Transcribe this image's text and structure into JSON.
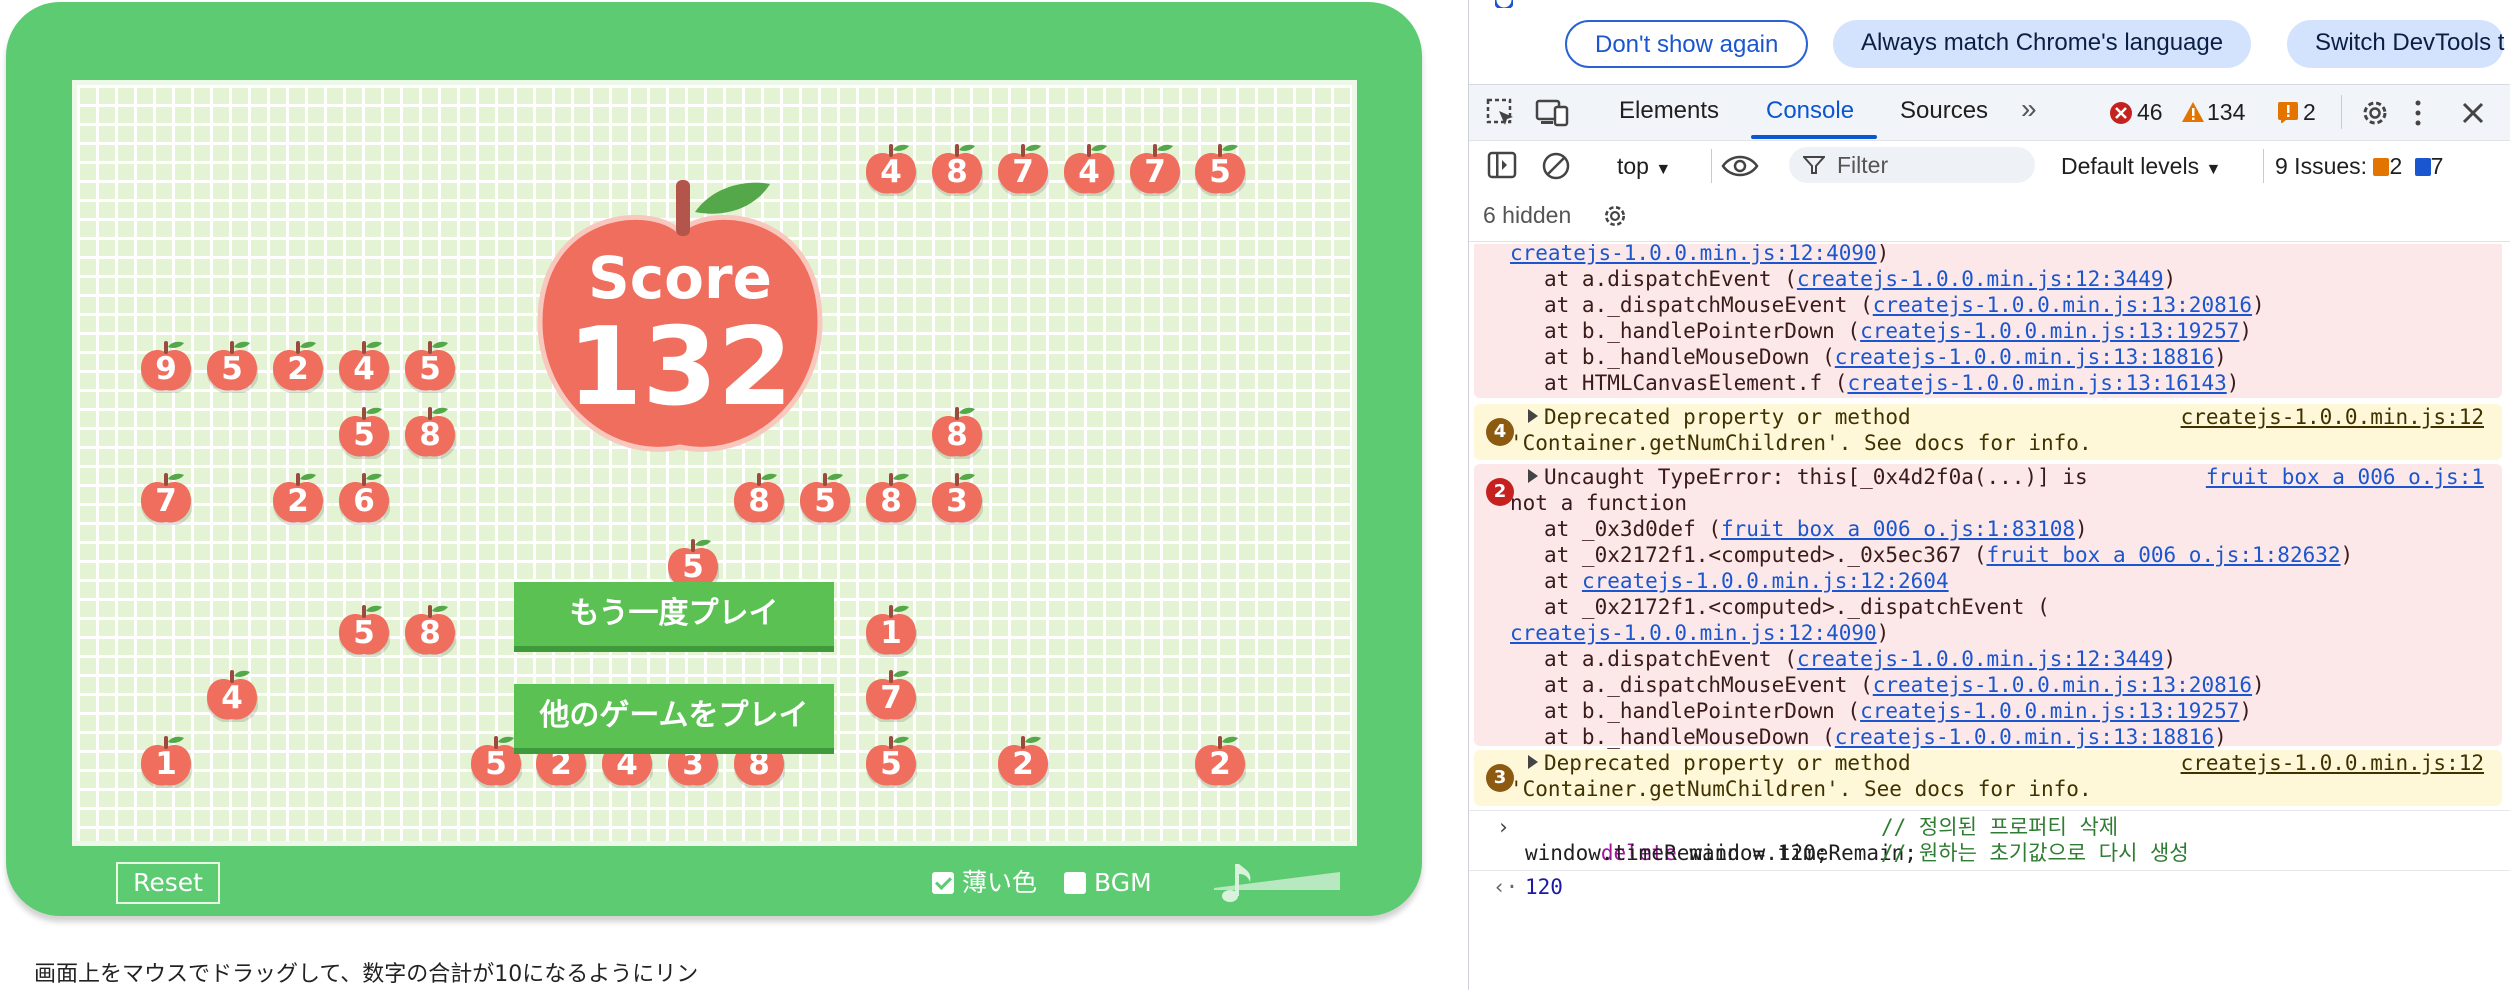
{
  "game": {
    "score_label": "Score",
    "score_value": "132",
    "play_again_label": "もう一度プレイ",
    "other_games_label": "他のゲームをプレイ",
    "reset_label": "Reset",
    "light_color_label": "薄い色",
    "light_color_checked": true,
    "bgm_label": "BGM",
    "bgm_checked": false,
    "volume_level": 0.0,
    "caption": "画面上をマウスでドラッグして、数字の合計が10になるようにリン",
    "apple_color": "#ef6e5d",
    "board_color": "#e4f3d4",
    "frame_color": "#5dcb71",
    "button_color": "#5bc152",
    "apples": [
      {
        "row": 1,
        "col": 12,
        "value": "4"
      },
      {
        "row": 1,
        "col": 13,
        "value": "8"
      },
      {
        "row": 1,
        "col": 14,
        "value": "7"
      },
      {
        "row": 1,
        "col": 15,
        "value": "4"
      },
      {
        "row": 1,
        "col": 16,
        "value": "7"
      },
      {
        "row": 1,
        "col": 17,
        "value": "5"
      },
      {
        "row": 4,
        "col": 1,
        "value": "9"
      },
      {
        "row": 4,
        "col": 2,
        "value": "5"
      },
      {
        "row": 4,
        "col": 3,
        "value": "2"
      },
      {
        "row": 4,
        "col": 4,
        "value": "4"
      },
      {
        "row": 4,
        "col": 5,
        "value": "5"
      },
      {
        "row": 5,
        "col": 4,
        "value": "5"
      },
      {
        "row": 5,
        "col": 5,
        "value": "8"
      },
      {
        "row": 5,
        "col": 13,
        "value": "8"
      },
      {
        "row": 6,
        "col": 1,
        "value": "7"
      },
      {
        "row": 6,
        "col": 3,
        "value": "2"
      },
      {
        "row": 6,
        "col": 4,
        "value": "6"
      },
      {
        "row": 6,
        "col": 10,
        "value": "8"
      },
      {
        "row": 6,
        "col": 11,
        "value": "5"
      },
      {
        "row": 6,
        "col": 12,
        "value": "8"
      },
      {
        "row": 6,
        "col": 13,
        "value": "3"
      },
      {
        "row": 7,
        "col": 9,
        "value": "5"
      },
      {
        "row": 8,
        "col": 4,
        "value": "5"
      },
      {
        "row": 8,
        "col": 5,
        "value": "8"
      },
      {
        "row": 8,
        "col": 12,
        "value": "1"
      },
      {
        "row": 9,
        "col": 2,
        "value": "4"
      },
      {
        "row": 9,
        "col": 12,
        "value": "7"
      },
      {
        "row": 10,
        "col": 1,
        "value": "1"
      },
      {
        "row": 10,
        "col": 6,
        "value": "5"
      },
      {
        "row": 10,
        "col": 7,
        "value": "2"
      },
      {
        "row": 10,
        "col": 8,
        "value": "4"
      },
      {
        "row": 10,
        "col": 9,
        "value": "3"
      },
      {
        "row": 10,
        "col": 10,
        "value": "8"
      },
      {
        "row": 10,
        "col": 12,
        "value": "5"
      },
      {
        "row": 10,
        "col": 14,
        "value": "2"
      },
      {
        "row": 10,
        "col": 17,
        "value": "2"
      }
    ]
  },
  "devtools": {
    "banner": {
      "dont_show_again": "Don't show again",
      "always_match": "Always match Chrome's language",
      "switch_devtools": "Switch DevTools t"
    },
    "tabs": {
      "elements": "Elements",
      "console": "Console",
      "sources": "Sources",
      "more": "»"
    },
    "counts": {
      "errors": "46",
      "warnings": "134",
      "issues": "2"
    },
    "console_toolbar": {
      "context": "top",
      "filter_placeholder": "Filter",
      "levels": "Default levels",
      "issues_label": "9 Issues:",
      "issues_warn": "2",
      "issues_info": "7"
    },
    "hidden_label": "6 hidden",
    "colors": {
      "accent": "#0b57d0",
      "error_bg": "#fce8e8",
      "warn_bg": "#fff8d8",
      "error_badge": "#c5221f",
      "warn_badge": "#8d5a12"
    },
    "msg1": {
      "lines": [
        {
          "pre": "",
          "link": "createjs-1.0.0.min.js:12:4090",
          "post": ")",
          "indent": 0
        },
        {
          "pre": "at a.dispatchEvent (",
          "link": "createjs-1.0.0.min.js:12:3449",
          "post": ")",
          "indent": 1
        },
        {
          "pre": "at a._dispatchMouseEvent (",
          "link": "createjs-1.0.0.min.js:13:20816",
          "post": ")",
          "indent": 1
        },
        {
          "pre": "at b._handlePointerDown (",
          "link": "createjs-1.0.0.min.js:13:19257",
          "post": ")",
          "indent": 1
        },
        {
          "pre": "at b._handleMouseDown (",
          "link": "createjs-1.0.0.min.js:13:18816",
          "post": ")",
          "indent": 1
        },
        {
          "pre": "at HTMLCanvasElement.f (",
          "link": "createjs-1.0.0.min.js:13:16143",
          "post": ")",
          "indent": 1
        }
      ]
    },
    "msg2": {
      "count": "4",
      "line1": "Deprecated property or method",
      "line2": "'Container.getNumChildren'. See docs for info.",
      "source": "createjs-1.0.0.min.js:12"
    },
    "msg3": {
      "count": "2",
      "head": "Uncaught TypeError: this[_0x4d2f0a(...)] is",
      "head2": "not a function",
      "source": "fruit box a 006 o.js:1",
      "lines": [
        {
          "pre": "at _0x3d0def (",
          "link": "fruit box a 006 o.js:1:83108",
          "post": ")",
          "indent": 1
        },
        {
          "pre": "at _0x2172f1.<computed>._0x5ec367 (",
          "link": "fruit box a 006 o.js:1:82632",
          "post": ")",
          "indent": 1
        },
        {
          "pre": "at ",
          "link": "createjs-1.0.0.min.js:12:2604",
          "post": "",
          "indent": 1
        },
        {
          "pre": "at _0x2172f1.<computed>._dispatchEvent (",
          "link": "",
          "post": "",
          "indent": 1
        },
        {
          "pre": "",
          "link": "createjs-1.0.0.min.js:12:4090",
          "post": ")",
          "indent": 0
        },
        {
          "pre": "at a.dispatchEvent (",
          "link": "createjs-1.0.0.min.js:12:3449",
          "post": ")",
          "indent": 1
        },
        {
          "pre": "at a._dispatchMouseEvent (",
          "link": "createjs-1.0.0.min.js:13:20816",
          "post": ")",
          "indent": 1
        },
        {
          "pre": "at b._handlePointerDown (",
          "link": "createjs-1.0.0.min.js:13:19257",
          "post": ")",
          "indent": 1
        },
        {
          "pre": "at b._handleMouseDown (",
          "link": "createjs-1.0.0.min.js:13:18816",
          "post": ")",
          "indent": 1
        },
        {
          "pre": "at HTMLCanvasElement.f (",
          "link": "createjs-1.0.0.min.js:13:16143",
          "post": ")",
          "indent": 1
        }
      ]
    },
    "msg4": {
      "count": "3",
      "line1": "Deprecated property or method",
      "line2": "'Container.getNumChildren'. See docs for info.",
      "source": "createjs-1.0.0.min.js:12"
    },
    "input": {
      "l1_kw": "delete",
      "l1_code": " window.timeRemain;",
      "l1_comment": "// 정의된 프로퍼티 삭제",
      "l2_code": "window.timeRemain = 120;",
      "l2_comment": "// 원하는 초기값으로 다시 생성"
    },
    "result": "120"
  }
}
